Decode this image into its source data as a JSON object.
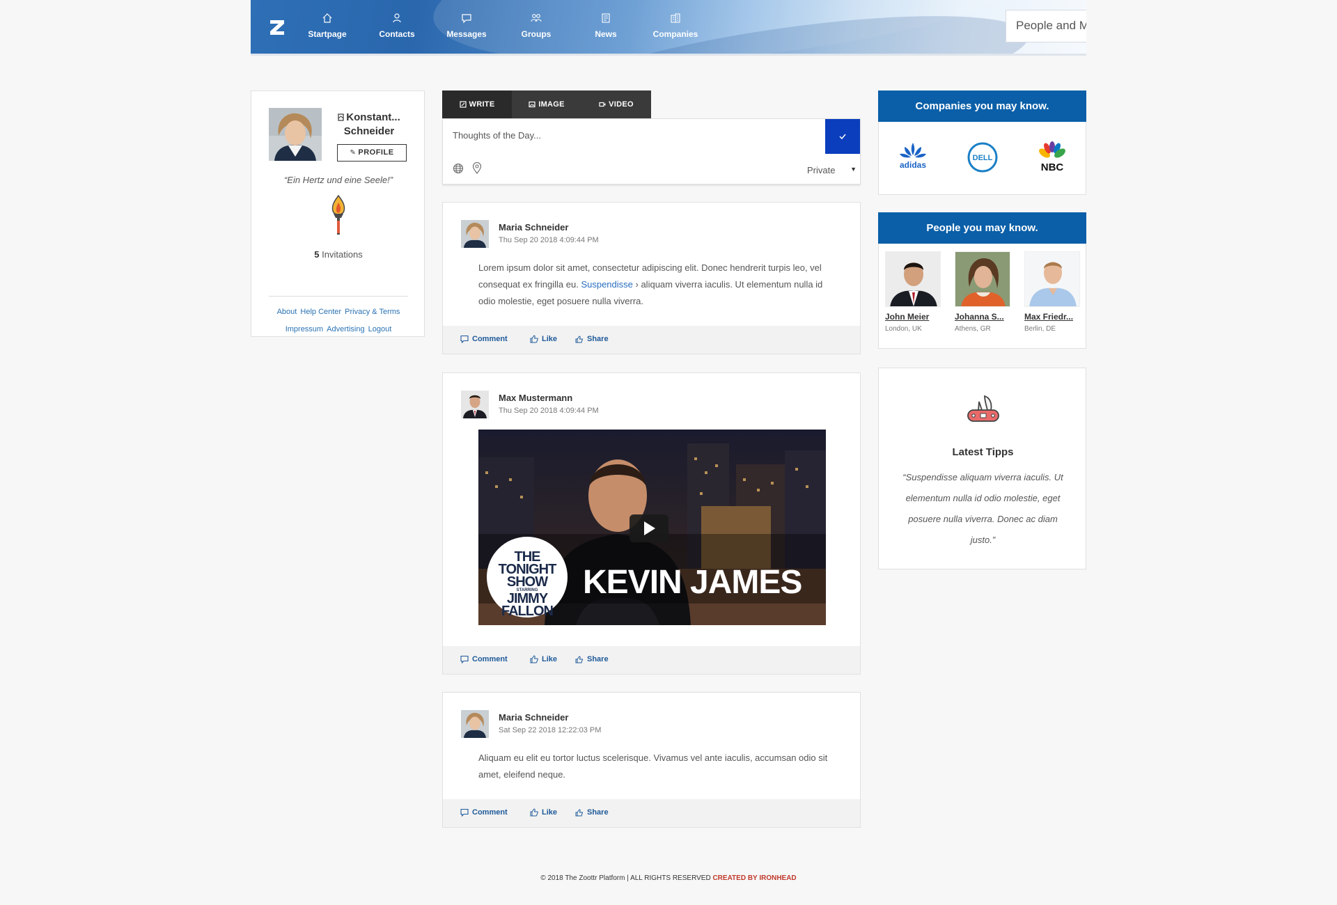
{
  "header": {
    "nav": [
      {
        "label": "Startpage",
        "icon": "home-icon"
      },
      {
        "label": "Contacts",
        "icon": "user-icon"
      },
      {
        "label": "Messages",
        "icon": "message-icon"
      },
      {
        "label": "Groups",
        "icon": "groups-icon"
      },
      {
        "label": "News",
        "icon": "news-icon"
      },
      {
        "label": "Companies",
        "icon": "building-icon"
      }
    ],
    "search_placeholder": "People and More..."
  },
  "profile": {
    "name_line1": "Konstant...",
    "name_line2": "Schneider",
    "button_label": "PROFILE",
    "quote": "“Ein Hertz und eine Seele!”",
    "invitations_count": "5",
    "invitations_label": "Invitations",
    "links_row1": [
      "About",
      "Help Center",
      "Privacy & Terms"
    ],
    "links_row2": [
      "Impressum",
      "Advertising",
      "Logout"
    ]
  },
  "composer": {
    "tabs": [
      "WRITE",
      "IMAGE",
      "VIDEO"
    ],
    "placeholder": "Thoughts of the Day...",
    "privacy": "Private"
  },
  "posts": [
    {
      "author": "Maria Schneider",
      "date": "Thu Sep 20 2018 4:09:44 PM",
      "body_before": "Lorem ipsum dolor sit amet, consectetur adipiscing elit. Donec hendrerit turpis leo, vel consequat ex fringilla eu.",
      "body_link": "Suspendisse",
      "body_after": "› aliquam viverra iaculis. Ut elementum nulla id odio molestie, eget posuere nulla viverra."
    },
    {
      "author": "Max Mustermann",
      "date": "Thu Sep 20 2018 4:09:44 PM",
      "video_logo_line1": "THE",
      "video_logo_line2": "TONIGHT",
      "video_logo_line3": "SHOW",
      "video_logo_starring": "STARRING",
      "video_logo_line4": "JIMMY",
      "video_logo_line5": "FALLON",
      "video_caption": "KEVIN JAMES"
    },
    {
      "author": "Maria Schneider",
      "date": "Sat Sep 22 2018 12:22:03 PM",
      "body": "Aliquam eu elit eu tortor luctus scelerisque. Vivamus vel ante iaculis, accumsan odio sit amet, eleifend neque."
    }
  ],
  "actions": {
    "comment": "Comment",
    "like": "Like",
    "share": "Share"
  },
  "companies": {
    "title": "Companies you may know.",
    "logos": [
      "adidas",
      "DELL",
      "NBC"
    ]
  },
  "people": {
    "title": "People you may know.",
    "list": [
      {
        "name": "John Meier",
        "location": "London, UK"
      },
      {
        "name": "Johanna S...",
        "location": "Athens, GR"
      },
      {
        "name": "Max Friedr...",
        "location": "Berlin, DE"
      }
    ]
  },
  "tipps": {
    "title": "Latest Tipps",
    "text": "“Suspendisse aliquam viverra iaculis. Ut elementum nulla id odio molestie, eget posuere nulla viverra. Donec ac diam justo.”"
  },
  "footer": {
    "copyright": "© 2018 The Zoottr Platform | ALL RIGHTS RESERVED",
    "credit": "CREATED BY IRONHEAD"
  },
  "colors": {
    "accent_blue": "#0a5fa8",
    "submit_blue": "#0b3ebd",
    "link_blue": "#2a73b3",
    "credit_red": "#c0392b"
  }
}
